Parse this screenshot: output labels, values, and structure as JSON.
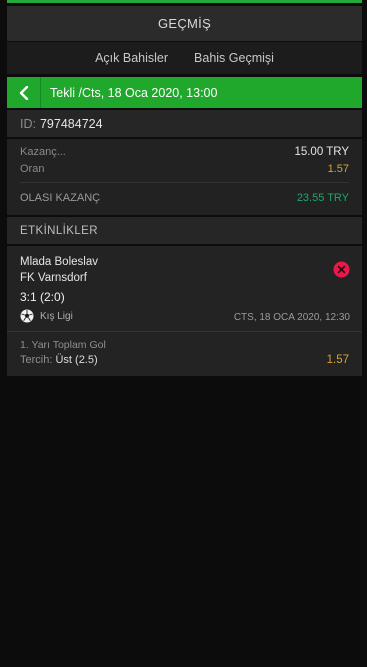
{
  "header": {
    "title": "GEÇMİŞ"
  },
  "tabs": [
    {
      "label": "Açık Bahisler"
    },
    {
      "label": "Bahis Geçmişi"
    }
  ],
  "bet": {
    "title": "Tekli /Cts, 18 Oca 2020, 13:00",
    "id_label": "ID:",
    "id_value": "797484724"
  },
  "stake": {
    "kazanc_label": "Kazanç...",
    "kazanc_value": "15.00 TRY",
    "oran_label": "Oran",
    "oran_value": "1.57",
    "olasi_label": "OLASI KAZANÇ",
    "olasi_value": "23.55 TRY"
  },
  "events_header": "ETKİNLİKLER",
  "event": {
    "home": "Mlada Boleslav",
    "away": "FK Varnsdorf",
    "score": "3:1 (2:0)",
    "league": "Kış Ligi",
    "date": "CTS, 18 OCA 2020, 12:30",
    "market": "1. Yarı Toplam Gol",
    "pick_label": "Tercih:",
    "pick_value": "Üst (2.5)",
    "odds": "1.57"
  },
  "colors": {
    "accent_green": "#20a82c",
    "odds_orange": "#d7a336",
    "win_green": "#1fa66a",
    "remove_pink": "#e8194a"
  },
  "icons": {
    "back": "chevron-left-icon",
    "remove": "close-circle-icon",
    "sport": "soccer-ball-icon"
  }
}
